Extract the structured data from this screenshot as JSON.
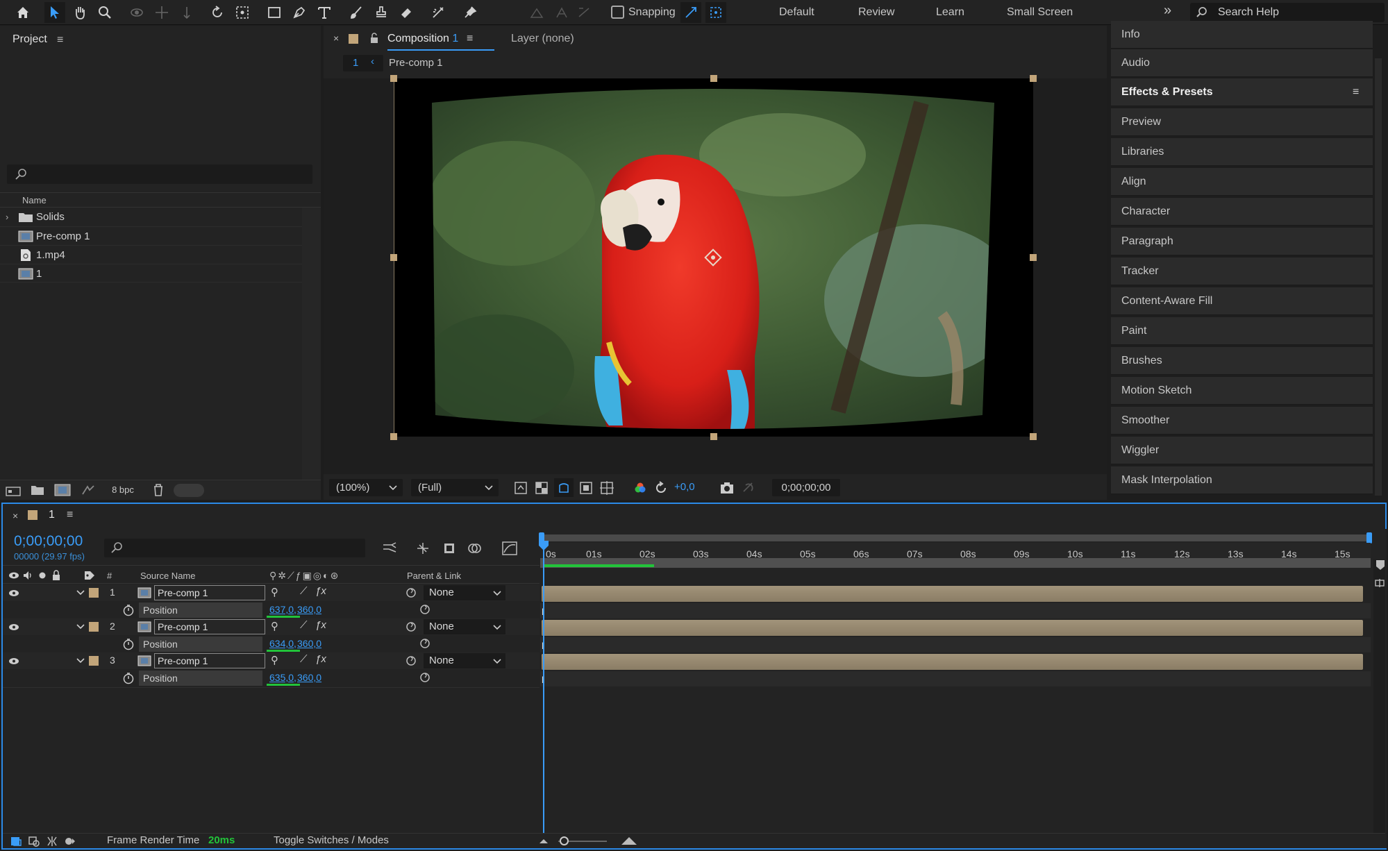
{
  "workspaces": [
    "Default",
    "Review",
    "Learn",
    "Small Screen"
  ],
  "toolbar": {
    "snapping_label": "Snapping",
    "search_placeholder": "Search Help"
  },
  "project_panel": {
    "title": "Project",
    "column_name": "Name",
    "items": [
      {
        "name": "Solids",
        "type": "folder"
      },
      {
        "name": "Pre-comp 1",
        "type": "composition"
      },
      {
        "name": "1.mp4",
        "type": "footage"
      },
      {
        "name": "1",
        "type": "composition"
      }
    ],
    "bpc_label": "8 bpc"
  },
  "comp_panel": {
    "tab_label": "Composition",
    "tab_number": "1",
    "layer_tab": "Layer (none)",
    "breadcrumb_number": "1",
    "breadcrumb_label": "Pre-comp 1",
    "zoom": "(100%)",
    "resolution": "(Full)",
    "exposure": "+0,0",
    "timecode": "0;00;00;00"
  },
  "right_panels": [
    "Info",
    "Audio",
    "Effects & Presets",
    "Preview",
    "Libraries",
    "Align",
    "Character",
    "Paragraph",
    "Tracker",
    "Content-Aware Fill",
    "Paint",
    "Brushes",
    "Motion Sketch",
    "Smoother",
    "Wiggler",
    "Mask Interpolation"
  ],
  "timeline": {
    "tab_label": "1",
    "timecode": "0;00;00;00",
    "frame_info": "00000 (29.97 fps)",
    "col_number": "#",
    "col_source": "Source Name",
    "col_parent": "Parent & Link",
    "ruler_ticks": [
      "0s",
      "01s",
      "02s",
      "03s",
      "04s",
      "05s",
      "06s",
      "07s",
      "08s",
      "09s",
      "10s",
      "11s",
      "12s",
      "13s",
      "14s",
      "15s"
    ],
    "layers": [
      {
        "num": "1",
        "name": "Pre-comp 1",
        "prop": "Position",
        "x": "637,0",
        "y": "360,0",
        "parent": "None"
      },
      {
        "num": "2",
        "name": "Pre-comp 1",
        "prop": "Position",
        "x": "634,0",
        "y": "360,0",
        "parent": "None"
      },
      {
        "num": "3",
        "name": "Pre-comp 1",
        "prop": "Position",
        "x": "635,0",
        "y": "360,0",
        "parent": "None"
      }
    ],
    "footer_render_label": "Frame Render Time",
    "footer_render_value": "20ms",
    "footer_toggle": "Toggle Switches / Modes"
  },
  "colors": {
    "accent": "#3a9cf7",
    "label_tan": "#c2a57a",
    "bar_tan": "#9a8c72",
    "green": "#22c33a"
  }
}
